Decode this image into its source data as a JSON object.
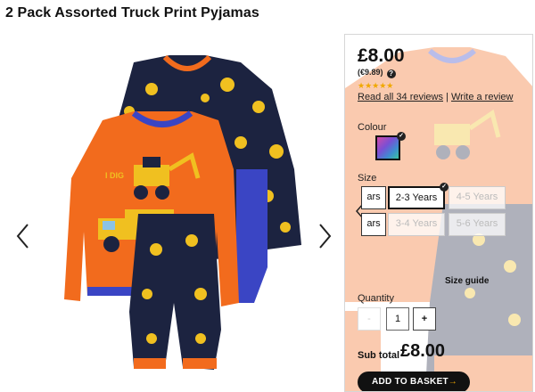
{
  "product": {
    "title": "2 Pack Assorted Truck Print Pyjamas"
  },
  "gallery": {
    "prev_icon": "chevron-left-icon",
    "next_icon": "chevron-right-icon"
  },
  "panel": {
    "price": "£8.00",
    "price_eur": "(€9.89)",
    "help_icon": "?",
    "stars": "★★★★★",
    "rating": 4.5,
    "reviews_link": "Read all 34 reviews",
    "separator": "|",
    "write_review_link": "Write a review",
    "colour_label": "Colour",
    "size_label": "Size",
    "sizes": [
      {
        "label": "ars",
        "state": "partial"
      },
      {
        "label": "2-3 Years",
        "state": "selected"
      },
      {
        "label": "4-5 Years",
        "state": "unavailable"
      },
      {
        "label": "ars",
        "state": "partial"
      },
      {
        "label": "3-4 Years",
        "state": "unavailable"
      },
      {
        "label": "5-6 Years",
        "state": "unavailable"
      }
    ],
    "size_guide": "Size guide",
    "quantity_label": "Quantity",
    "qty_minus": "-",
    "qty_value": "1",
    "qty_plus": "+",
    "subtotal_label": "Sub total",
    "subtotal_value": "£8.00",
    "basket_button": "ADD TO BASKET",
    "basket_arrow": "→"
  },
  "colors": {
    "accent": "#f0a800",
    "orange": "#f26b1d",
    "navy": "#1c2340",
    "royal_blue": "#3a45c4"
  }
}
